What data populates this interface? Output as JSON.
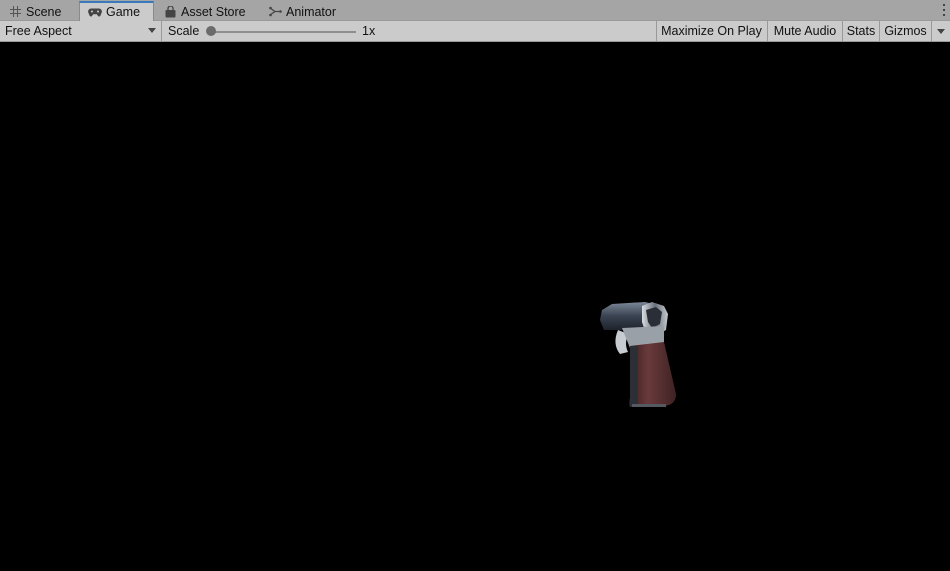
{
  "tabs": [
    {
      "label": "Scene",
      "icon": "grid-icon"
    },
    {
      "label": "Game",
      "icon": "gamepad-icon",
      "active": true
    },
    {
      "label": "Asset Store",
      "icon": "shopping-bag-icon"
    },
    {
      "label": "Animator",
      "icon": "animator-icon"
    }
  ],
  "toolbar": {
    "aspect": "Free Aspect",
    "scale_label": "Scale",
    "scale_value": "1x",
    "maximize_on_play": "Maximize On Play",
    "mute_audio": "Mute Audio",
    "stats": "Stats",
    "gizmos": "Gizmos"
  },
  "colors": {
    "tab_bar_bg": "#a5a5a5",
    "toolbar_bg": "#cbcbcb",
    "active_tab_accent": "#3a79bb",
    "viewport_bg": "#000000"
  }
}
